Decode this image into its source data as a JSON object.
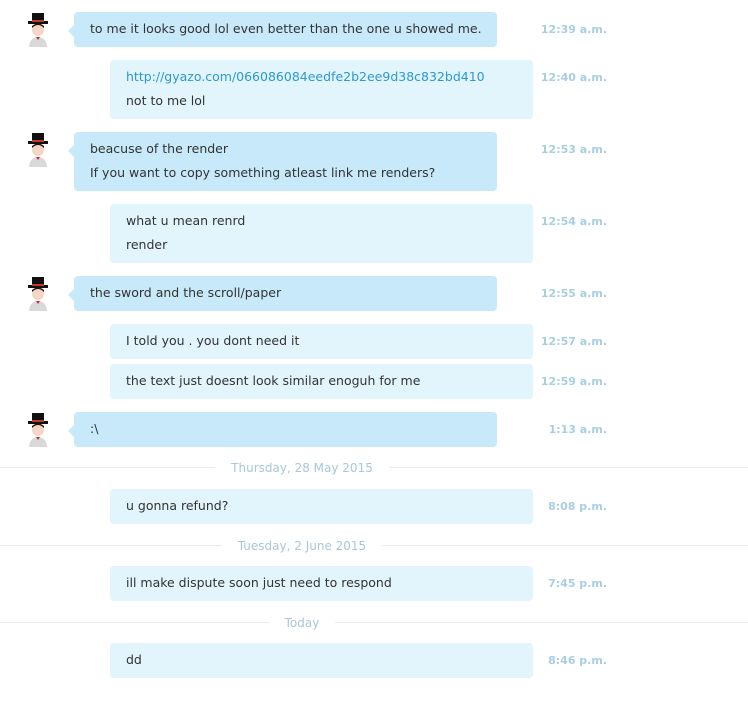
{
  "chat": {
    "messages": [
      {
        "lines": [
          "to me it looks good lol even better than the one u showed me."
        ],
        "time": "12:39 a.m."
      },
      {
        "link": "http://gyazo.com/066086084eedfe2b2ee9d38c832bd410",
        "lines": [
          "not to me lol"
        ],
        "time": "12:40 a.m."
      },
      {
        "lines": [
          "beacuse of the render",
          "If you want to copy something atleast link me renders?"
        ],
        "time": "12:53 a.m."
      },
      {
        "lines": [
          "what u mean renrd",
          "render"
        ],
        "time": "12:54 a.m."
      },
      {
        "lines": [
          "the sword and the scroll/paper"
        ],
        "time": "12:55 a.m."
      },
      {
        "lines": [
          "I told you . you dont need it"
        ],
        "time": "12:57 a.m."
      },
      {
        "lines": [
          "the text just doesnt look similar enoguh for me"
        ],
        "time": "12:59 a.m."
      },
      {
        "lines": [
          ":\\"
        ],
        "time": "1:13 a.m."
      },
      {
        "lines": [
          "u gonna refund?"
        ],
        "time": "8:08 p.m."
      },
      {
        "lines": [
          "ill make dispute soon just need to respond"
        ],
        "time": "7:45 p.m."
      },
      {
        "lines": [
          "dd"
        ],
        "time": "8:46 p.m."
      }
    ],
    "separators": [
      "Thursday, 28 May 2015",
      "Tuesday, 2 June 2015",
      "Today"
    ]
  },
  "colors": {
    "incoming_bubble": "#c7e9f9",
    "outgoing_bubble": "#e2f4fc",
    "link": "#2a9ad3",
    "timestamp": "#a9cde3",
    "separator_text": "#a9c7d8"
  },
  "icons": {
    "avatar": "top-hat-character-avatar-icon"
  }
}
